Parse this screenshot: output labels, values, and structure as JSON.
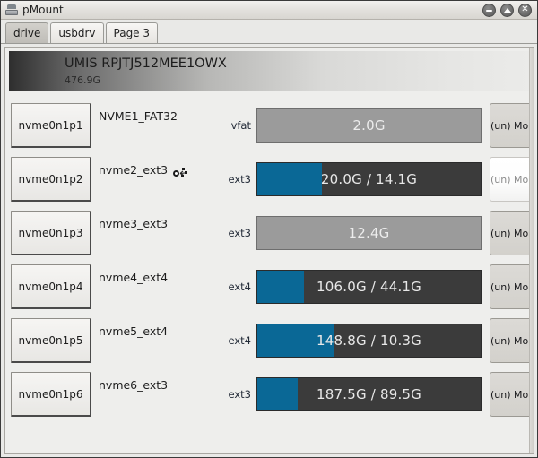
{
  "window": {
    "title": "pMount",
    "icon": "drive-icon",
    "controls": [
      {
        "name": "minimize-button",
        "glyph": "minimize"
      },
      {
        "name": "maximize-button",
        "glyph": "maximize"
      },
      {
        "name": "close-button",
        "glyph": "close"
      }
    ]
  },
  "tabs": [
    {
      "label": "drive",
      "active": true
    },
    {
      "label": "usbdrv",
      "active": false
    },
    {
      "label": "Page 3",
      "active": false
    }
  ],
  "device": {
    "name": "UMIS RPJTJ512MEE1OWX",
    "size": "476.9G"
  },
  "colors": {
    "used_bar": "#0a6896",
    "free_bar": "#3b3b3b",
    "unmounted_bar": "#9b9b9b",
    "accent_tab_active": "#c8c6c1"
  },
  "mount_button_label": "(un) Mount",
  "partitions": [
    {
      "device": "nvme0n1p1",
      "label": "NVME1_FAT32",
      "fstype": "vfat",
      "bar_text": "2.0G",
      "mounted": false,
      "used_percent": 0,
      "has_mount_icon": false,
      "button_hover": false
    },
    {
      "device": "nvme0n1p2",
      "label": "nvme2_ext3",
      "fstype": "ext3",
      "bar_text": "20.0G / 14.1G",
      "mounted": true,
      "used_percent": 29,
      "has_mount_icon": true,
      "button_hover": true
    },
    {
      "device": "nvme0n1p3",
      "label": "nvme3_ext3",
      "fstype": "ext3",
      "bar_text": "12.4G",
      "mounted": false,
      "used_percent": 0,
      "has_mount_icon": false,
      "button_hover": false
    },
    {
      "device": "nvme0n1p4",
      "label": "nvme4_ext4",
      "fstype": "ext4",
      "bar_text": "106.0G / 44.1G",
      "mounted": true,
      "used_percent": 21,
      "has_mount_icon": false,
      "button_hover": false
    },
    {
      "device": "nvme0n1p5",
      "label": "nvme5_ext4",
      "fstype": "ext4",
      "bar_text": "148.8G / 10.3G",
      "mounted": true,
      "used_percent": 34,
      "has_mount_icon": false,
      "button_hover": false
    },
    {
      "device": "nvme0n1p6",
      "label": "nvme6_ext3",
      "fstype": "ext3",
      "bar_text": "187.5G / 89.5G",
      "mounted": true,
      "used_percent": 18,
      "has_mount_icon": false,
      "button_hover": false
    }
  ]
}
